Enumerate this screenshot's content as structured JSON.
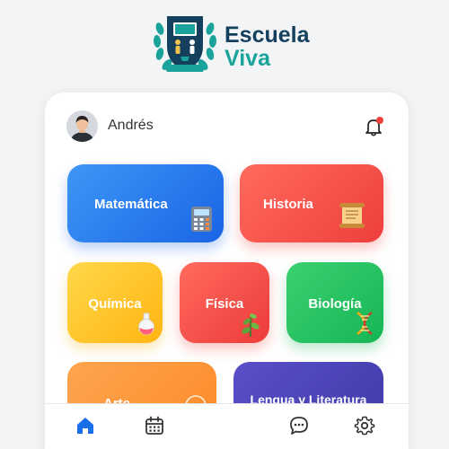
{
  "brand": {
    "line1": "Escuela",
    "line2": "Viva"
  },
  "header": {
    "user_name": "Andrés",
    "notification_dot": true
  },
  "subjects": [
    {
      "label": "Matemática",
      "icon": "calculator-icon"
    },
    {
      "label": "Historia",
      "icon": "scroll-icon"
    },
    {
      "label": "Química",
      "icon": "flask-icon"
    },
    {
      "label": "Física",
      "icon": "plant-icon"
    },
    {
      "label": "Biología",
      "icon": "dna-icon"
    },
    {
      "label": "Arte",
      "icon": "palette-icon"
    },
    {
      "label": "Lengua y Literatura",
      "icon": ""
    }
  ],
  "nav": [
    {
      "icon": "home-icon",
      "active": true
    },
    {
      "icon": "calendar-icon",
      "active": false
    },
    {
      "icon": "chat-icon",
      "active": false
    },
    {
      "icon": "gear-icon",
      "active": false
    }
  ],
  "colors": {
    "accent": "#1a6fe8",
    "brand_dark": "#14405e",
    "brand_teal": "#1aa39a",
    "notification": "#ee3f3c"
  }
}
